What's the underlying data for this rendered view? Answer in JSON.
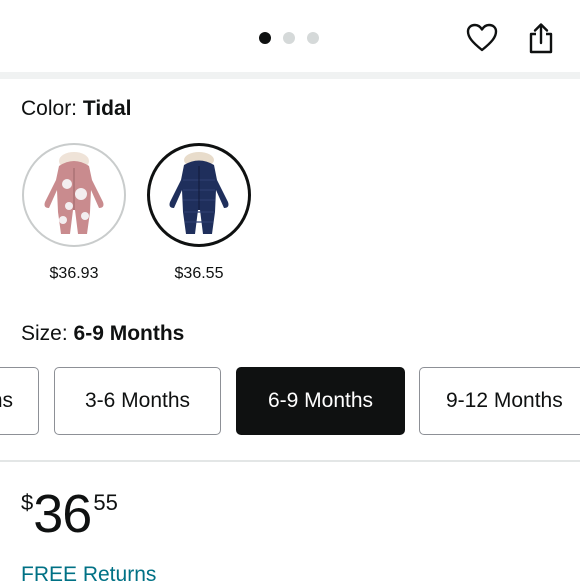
{
  "carousel": {
    "dot_count": 3,
    "active_index": 0
  },
  "header": {
    "favorite_icon": "heart-icon",
    "share_icon": "share-icon"
  },
  "color": {
    "label": "Color:",
    "selected": "Tidal",
    "options": [
      {
        "name": "pink-floral-snowsuit",
        "price": "$36.93",
        "selected": false
      },
      {
        "name": "navy-tidal-snowsuit",
        "price": "$36.55",
        "selected": true
      }
    ]
  },
  "size": {
    "label": "Size:",
    "selected": "6-9 Months",
    "options": [
      {
        "label": "ns",
        "selected": false
      },
      {
        "label": "3-6 Months",
        "selected": false
      },
      {
        "label": "6-9 Months",
        "selected": true
      },
      {
        "label": "9-12 Months",
        "selected": false
      }
    ]
  },
  "price": {
    "symbol": "$",
    "whole": "36",
    "fraction": "55"
  },
  "returns": {
    "label": "FREE Returns"
  },
  "colors": {
    "accent_link": "#007185",
    "selected_bg": "#0f1111",
    "pink": "#c98b8e",
    "navy": "#1f2f5c"
  }
}
